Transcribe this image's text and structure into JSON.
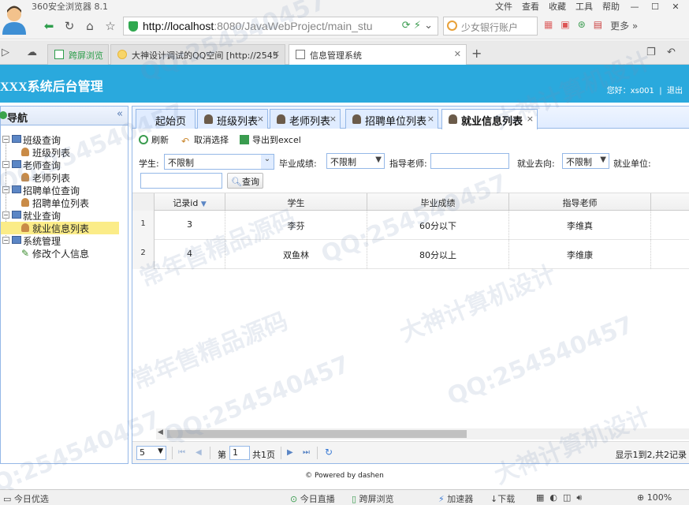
{
  "browser": {
    "app_name": "360安全浏览器 8.1",
    "menu": [
      "文件",
      "查看",
      "收藏",
      "工具",
      "帮助"
    ],
    "url_host": "http://localhost",
    "url_rest": ":8080/JavaWebProject/main_stu",
    "search_text": "少女银行账户",
    "more_label": "更多",
    "tabs": [
      {
        "label": "跨屏浏览"
      },
      {
        "label": "大神设计调试的QQ空间 [http://2545"
      },
      {
        "label": "信息管理系统"
      }
    ]
  },
  "app": {
    "title": "XXX系统后台管理",
    "user_greeting": "您好：xs001",
    "logout": "退出",
    "footer": "© Powered by dashen"
  },
  "sidebar": {
    "title": "导航",
    "groups": [
      {
        "label": "班级查询",
        "children": [
          "班级列表"
        ]
      },
      {
        "label": "老师查询",
        "children": [
          "老师列表"
        ]
      },
      {
        "label": "招聘单位查询",
        "children": [
          "招聘单位列表"
        ]
      },
      {
        "label": "就业查询",
        "children": [
          "就业信息列表"
        ]
      },
      {
        "label": "系统管理",
        "children": [
          "修改个人信息"
        ]
      }
    ]
  },
  "content_tabs": [
    {
      "label": "起始页"
    },
    {
      "label": "班级列表"
    },
    {
      "label": "老师列表"
    },
    {
      "label": "招聘单位列表"
    },
    {
      "label": "就业信息列表"
    }
  ],
  "toolbar": {
    "refresh": "刷新",
    "cancel_select": "取消选择",
    "export": "导出到excel"
  },
  "filters": {
    "student_label": "学生:",
    "student_value": "不限制",
    "grade_label": "毕业成绩:",
    "grade_value": "不限制",
    "teacher_label": "指导老师:",
    "teacher_value": "",
    "destination_label": "就业去向:",
    "destination_value": "不限制",
    "employer_label": "就业单位:",
    "query_button": "查询"
  },
  "table": {
    "columns": [
      "记录id",
      "学生",
      "毕业成绩",
      "指导老师"
    ],
    "rows": [
      {
        "num": "1",
        "id": "3",
        "student": "李芬",
        "grade": "60分以下",
        "teacher": "李维真"
      },
      {
        "num": "2",
        "id": "4",
        "student": "双鱼林",
        "grade": "80分以上",
        "teacher": "李维康"
      }
    ]
  },
  "pager": {
    "page_size": "5",
    "page_prefix": "第",
    "page_value": "1",
    "page_suffix": "共1页",
    "summary": "显示1到2,共2记录"
  },
  "status_bar": {
    "left": "今日优选",
    "live": "今日直播",
    "cross": "跨屏浏览",
    "accel": "加速器",
    "download": "下载",
    "zoom": "100%"
  },
  "watermarks": [
    "QQ:254540457",
    "常年售精品源码",
    "大神计算机设计"
  ],
  "colors": {
    "header_blue": "#2aa9dd",
    "border_blue": "#95b8e7",
    "selected_yellow": "#fbec88"
  }
}
